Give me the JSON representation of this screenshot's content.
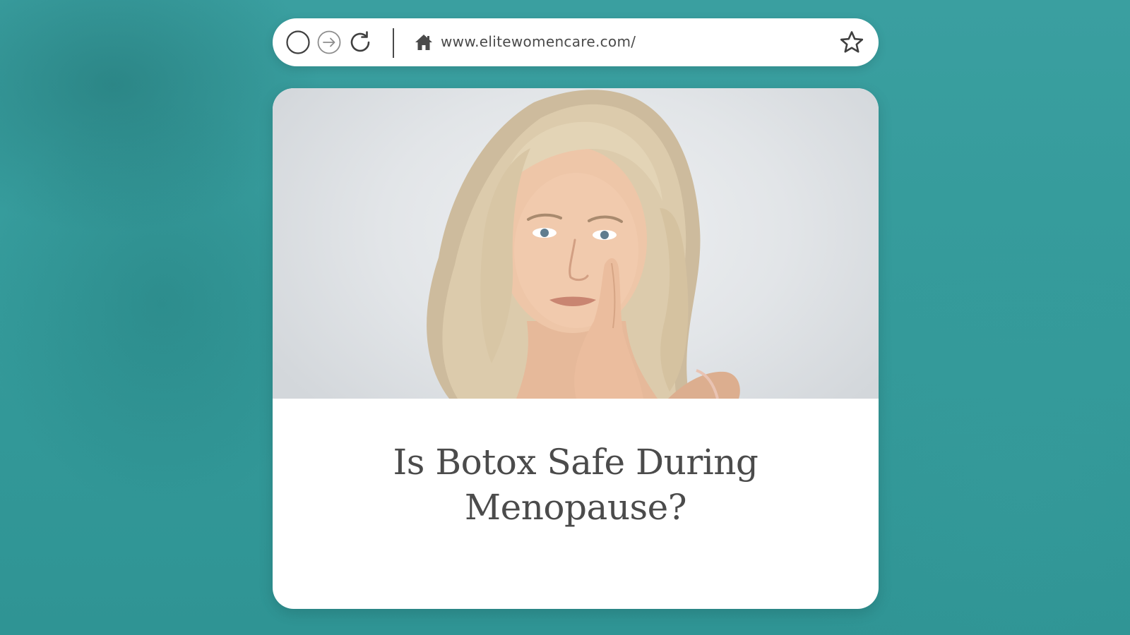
{
  "browser": {
    "url": "www.elitewomencare.com/",
    "icons": {
      "home": "home-icon",
      "bookmark": "star-icon",
      "reload": "reload-icon",
      "forward": "forward-arrow-icon",
      "circle": "circle-icon"
    }
  },
  "article": {
    "title_line1": "Is Botox Safe During",
    "title_line2": "Menopause?"
  },
  "colors": {
    "background_teal": "#349a9a",
    "card": "#ffffff",
    "title_text": "#4b4b4b",
    "url_text": "#4a4a4a"
  }
}
